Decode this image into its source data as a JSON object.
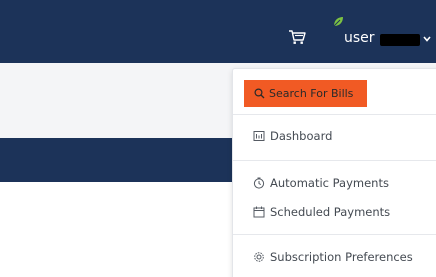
{
  "header": {
    "cart_icon": "cart-icon",
    "user_label": "user",
    "user_name_redacted": true,
    "leaf_icon": "leaf-icon",
    "chevron_icon": "chevron-down-icon"
  },
  "dropdown": {
    "search_button": {
      "label": "Search For Bills",
      "icon": "search-icon"
    },
    "items": [
      {
        "label": "Dashboard",
        "icon": "dashboard-icon"
      },
      {
        "label": "Automatic Payments",
        "icon": "clock-icon"
      },
      {
        "label": "Scheduled Payments",
        "icon": "calendar-icon"
      },
      {
        "label": "Subscription Preferences",
        "icon": "gear-icon"
      }
    ]
  },
  "colors": {
    "navy": "#1c3359",
    "accent_orange": "#f15a24",
    "subband": "#f4f5f7"
  }
}
